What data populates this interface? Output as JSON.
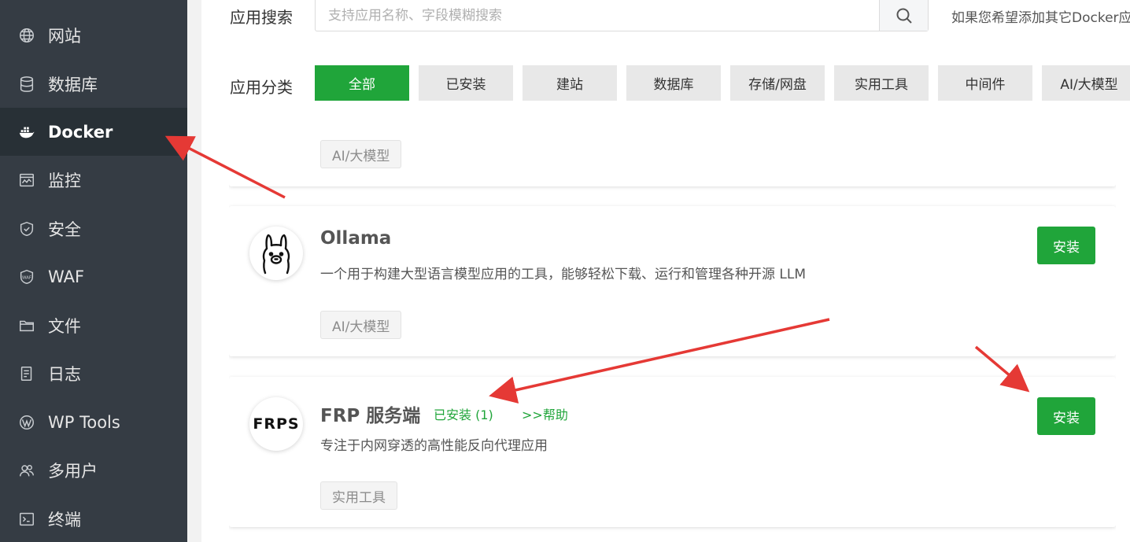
{
  "sidebar": {
    "items": [
      {
        "label": "网站",
        "icon": "globe-icon"
      },
      {
        "label": "数据库",
        "icon": "database-icon"
      },
      {
        "label": "Docker",
        "icon": "docker-icon",
        "active": true
      },
      {
        "label": "监控",
        "icon": "monitor-icon"
      },
      {
        "label": "安全",
        "icon": "shield-icon"
      },
      {
        "label": "WAF",
        "icon": "waf-shield-icon"
      },
      {
        "label": "文件",
        "icon": "folder-icon"
      },
      {
        "label": "日志",
        "icon": "log-icon"
      },
      {
        "label": "WP Tools",
        "icon": "wordpress-icon"
      },
      {
        "label": "多用户",
        "icon": "users-icon"
      },
      {
        "label": "终端",
        "icon": "terminal-icon"
      }
    ]
  },
  "search": {
    "label": "应用搜索",
    "placeholder": "支持应用名称、字段模糊搜索",
    "value": "",
    "hint": "如果您希望添加其它Docker应"
  },
  "categories": {
    "label": "应用分类",
    "items": [
      "全部",
      "已安装",
      "建站",
      "数据库",
      "存储/网盘",
      "实用工具",
      "中间件",
      "AI/大模型"
    ],
    "active_index": 0
  },
  "apps": [
    {
      "tag": "AI/大模型"
    },
    {
      "name": "Ollama",
      "desc": "一个用于构建大型语言模型应用的工具，能够轻松下载、运行和管理各种开源 LLM",
      "tag": "AI/大模型",
      "install_label": "安装"
    },
    {
      "name": "FRP 服务端",
      "logo_text": "FRPS",
      "status": "已安装 (1)",
      "help": ">>帮助",
      "desc": "专注于内网穿透的高性能反向代理应用",
      "tag": "实用工具",
      "install_label": "安装"
    }
  ],
  "colors": {
    "sidebar_bg": "#353c44",
    "sidebar_active_bg": "#283036",
    "accent": "#20a53a",
    "annotation_arrow": "#e53935"
  }
}
